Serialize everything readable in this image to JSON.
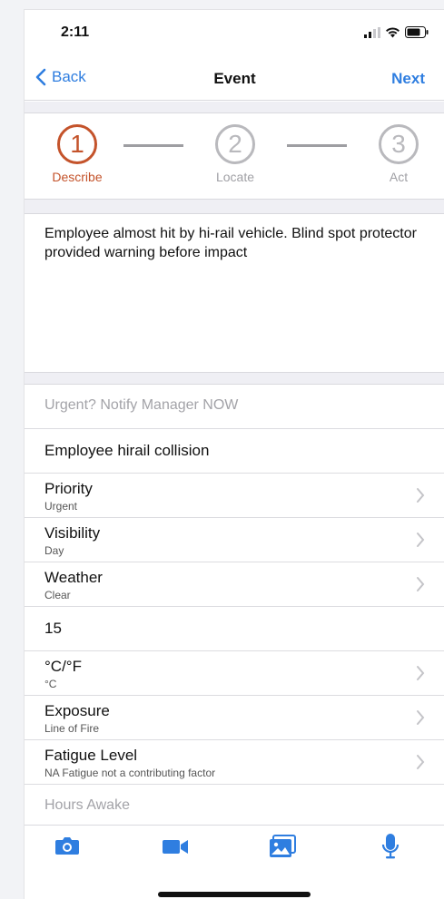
{
  "status_bar": {
    "time": "2:11"
  },
  "nav": {
    "back_label": "Back",
    "title": "Event",
    "next_label": "Next"
  },
  "stepper": {
    "steps": [
      {
        "number": "1",
        "label": "Describe",
        "active": true
      },
      {
        "number": "2",
        "label": "Locate",
        "active": false
      },
      {
        "number": "3",
        "label": "Act",
        "active": false
      }
    ]
  },
  "description": "Employee almost hit by hi-rail vehicle. Blind spot protector provided warning before impact",
  "fields": {
    "urgent_placeholder": "Urgent? Notify Manager NOW",
    "event_type": "Employee hirail collision",
    "priority": {
      "label": "Priority",
      "value": "Urgent"
    },
    "visibility": {
      "label": "Visibility",
      "value": "Day"
    },
    "weather": {
      "label": "Weather",
      "value": "Clear"
    },
    "temperature": "15",
    "temp_unit": {
      "label": "°C/°F",
      "value": "°C"
    },
    "exposure": {
      "label": "Exposure",
      "value": "Line of Fire"
    },
    "fatigue": {
      "label": "Fatigue Level",
      "value": "NA Fatigue not a contributing factor"
    },
    "hours_awake_placeholder": "Hours Awake"
  },
  "toolbar": {
    "icons": [
      "camera-icon",
      "video-icon",
      "photo-library-icon",
      "microphone-icon"
    ],
    "accent": "#2f7ee0"
  },
  "colors": {
    "accent": "#2f7ee0",
    "active_step": "#c4532b",
    "inactive_step": "#b9b9bd"
  }
}
